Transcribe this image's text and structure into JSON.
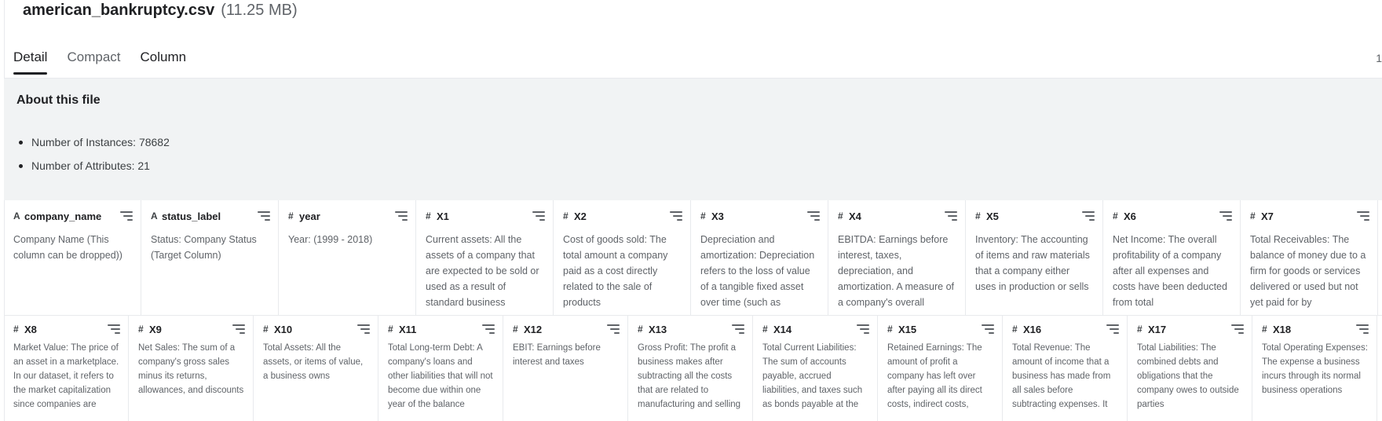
{
  "file": {
    "name": "american_bankruptcy.csv",
    "size": "(11.25 MB)"
  },
  "tabs": [
    {
      "label": "Detail",
      "active": true
    },
    {
      "label": "Compact",
      "active": false
    },
    {
      "label": "Column",
      "active": false
    }
  ],
  "tab_overflow": "1",
  "about": {
    "title": "About this file",
    "items": [
      "Number of Instances: 78682",
      "Number of Attributes: 21"
    ]
  },
  "columns_row1": [
    {
      "type": "A",
      "name": "company_name",
      "desc": "Company Name (This column can be dropped))"
    },
    {
      "type": "A",
      "name": "status_label",
      "desc": "Status: Company Status (Target Column)"
    },
    {
      "type": "#",
      "name": "year",
      "desc": "Year: (1999 - 2018)"
    },
    {
      "type": "#",
      "name": "X1",
      "desc": "Current assets: All the assets of a company that are expected to be sold or used as a result of standard business"
    },
    {
      "type": "#",
      "name": "X2",
      "desc": "Cost of goods sold: The total amount a company paid as a cost directly related to the sale of products"
    },
    {
      "type": "#",
      "name": "X3",
      "desc": "Depreciation and amortization: Depreciation refers to the loss of value of a tangible fixed asset over time (such as"
    },
    {
      "type": "#",
      "name": "X4",
      "desc": "EBITDA: Earnings before interest, taxes, depreciation, and amortization. A measure of a company's overall"
    },
    {
      "type": "#",
      "name": "X5",
      "desc": "Inventory: The accounting of items and raw materials that a company either uses in production or sells"
    },
    {
      "type": "#",
      "name": "X6",
      "desc": "Net Income: The overall profitability of a company after all expenses and costs have been deducted from total"
    },
    {
      "type": "#",
      "name": "X7",
      "desc": "Total Receivables: The balance of money due to a firm for goods or services delivered or used but not yet paid for by"
    }
  ],
  "columns_row2": [
    {
      "type": "#",
      "name": "X8",
      "desc": "Market Value: The price of an asset in a marketplace. In our dataset, it refers to the market capitalization since companies are"
    },
    {
      "type": "#",
      "name": "X9",
      "desc": "Net Sales: The sum of a company's gross sales minus its returns, allowances, and discounts"
    },
    {
      "type": "#",
      "name": "X10",
      "desc": "Total Assets: All the assets, or items of value, a business owns"
    },
    {
      "type": "#",
      "name": "X11",
      "desc": "Total Long-term Debt: A company's loans and other liabilities that will not become due within one year of the balance"
    },
    {
      "type": "#",
      "name": "X12",
      "desc": "EBIT: Earnings before interest and taxes"
    },
    {
      "type": "#",
      "name": "X13",
      "desc": "Gross Profit: The profit a business makes after subtracting all the costs that are related to manufacturing and selling"
    },
    {
      "type": "#",
      "name": "X14",
      "desc": "Total Current Liabilities: The sum of accounts payable, accrued liabilities, and taxes such as bonds payable at the"
    },
    {
      "type": "#",
      "name": "X15",
      "desc": "Retained Earnings: The amount of profit a company has left over after paying all its direct costs, indirect costs,"
    },
    {
      "type": "#",
      "name": "X16",
      "desc": "Total Revenue: The amount of income that a business has made from all sales before subtracting expenses. It"
    },
    {
      "type": "#",
      "name": "X17",
      "desc": "Total Liabilities: The combined debts and obligations that the company owes to outside parties"
    },
    {
      "type": "#",
      "name": "X18",
      "desc": "Total Operating Expenses: The expense a business incurs through its normal business operations"
    }
  ]
}
